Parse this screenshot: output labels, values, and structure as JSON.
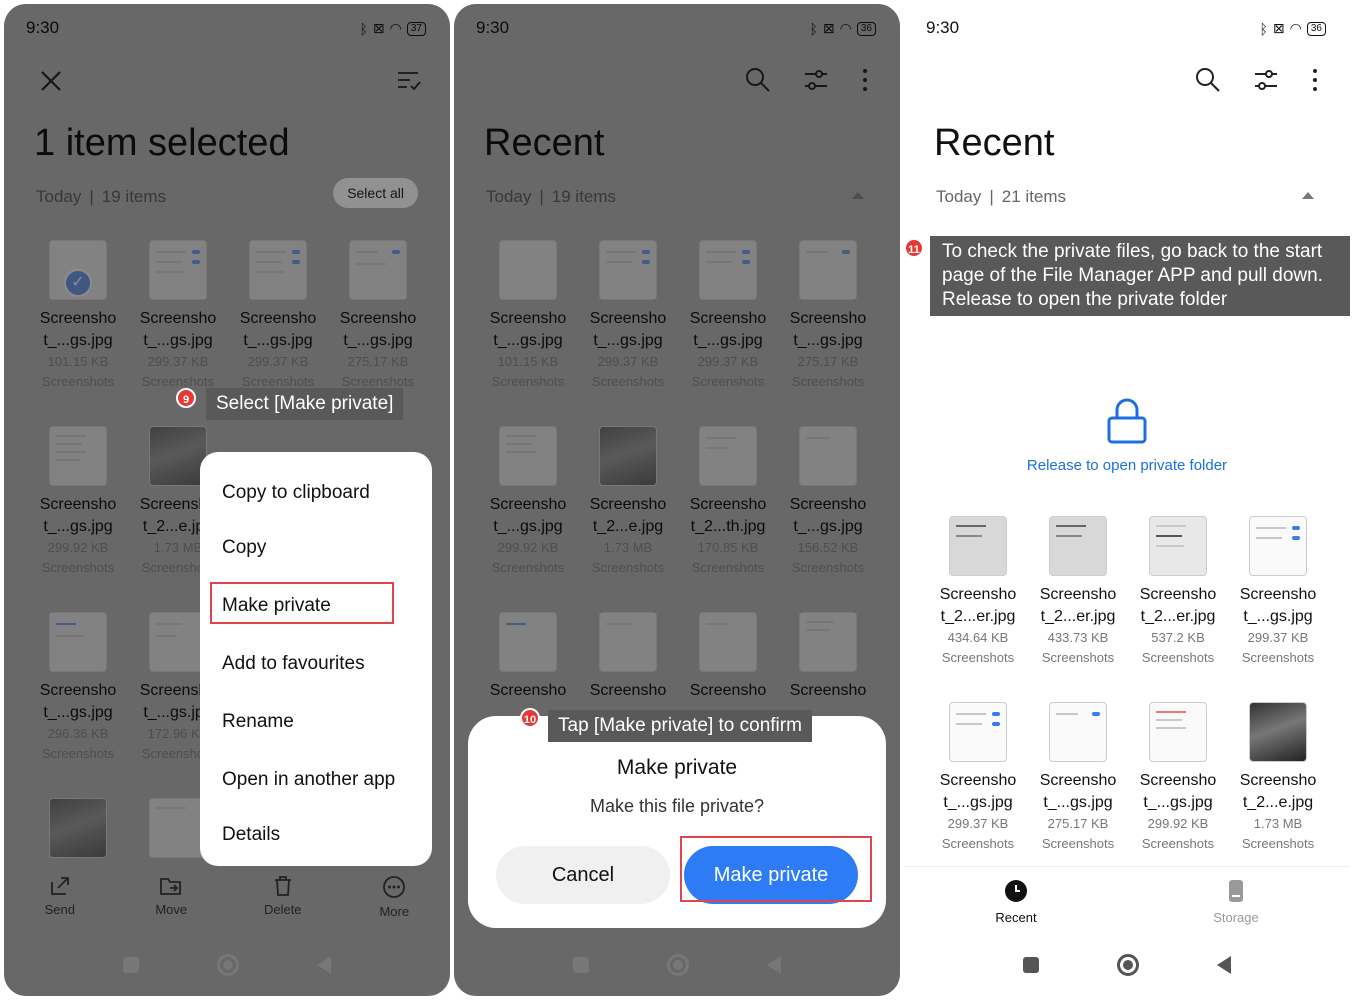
{
  "status": {
    "p1": {
      "time": "9:30",
      "battery": "37"
    },
    "p2": {
      "time": "9:30",
      "battery": "36"
    },
    "p3": {
      "time": "9:30",
      "battery": "36"
    }
  },
  "panel1": {
    "title": "1 item selected",
    "subhead": {
      "day": "Today",
      "sep": "|",
      "count": "19 items"
    },
    "select_all": "Select all",
    "files": [
      {
        "name1": "Screensho",
        "name2": "t_...gs.jpg",
        "size": "101.15 KB",
        "folder": "Screenshots"
      },
      {
        "name1": "Screensho",
        "name2": "t_...gs.jpg",
        "size": "299.37 KB",
        "folder": "Screenshots"
      },
      {
        "name1": "Screensho",
        "name2": "t_...gs.jpg",
        "size": "299.37 KB",
        "folder": "Screenshots"
      },
      {
        "name1": "Screensho",
        "name2": "t_...gs.jpg",
        "size": "275.17 KB",
        "folder": "Screenshots"
      },
      {
        "name1": "Screensho",
        "name2": "t_...gs.jpg",
        "size": "299.92 KB",
        "folder": "Screenshots"
      },
      {
        "name1": "Screensho",
        "name2": "t_2...e.jpg",
        "size": "1.73 MB",
        "folder": "Screenshots"
      },
      {
        "name1": "Screensho",
        "name2": "t_...gs.jpg",
        "size": "296.36 KB",
        "folder": "Screenshots"
      },
      {
        "name1": "Screensho",
        "name2": "t_...gs.jpg",
        "size": "172.96 KB",
        "folder": "Screenshots"
      }
    ],
    "menu": [
      "Copy to clipboard",
      "Copy",
      "Make private",
      "Add to favourites",
      "Rename",
      "Open in another app",
      "Details"
    ],
    "callout": {
      "num": "9",
      "text": "Select [Make private]"
    },
    "actions": [
      "Send",
      "Move",
      "Delete",
      "More"
    ]
  },
  "panel2": {
    "title": "Recent",
    "subhead": {
      "day": "Today",
      "sep": "|",
      "count": "19 items"
    },
    "files": [
      {
        "name1": "Screensho",
        "name2": "t_...gs.jpg",
        "size": "101.15 KB",
        "folder": "Screenshots"
      },
      {
        "name1": "Screensho",
        "name2": "t_...gs.jpg",
        "size": "299.37 KB",
        "folder": "Screenshots"
      },
      {
        "name1": "Screensho",
        "name2": "t_...gs.jpg",
        "size": "299.37 KB",
        "folder": "Screenshots"
      },
      {
        "name1": "Screensho",
        "name2": "t_...gs.jpg",
        "size": "275.17 KB",
        "folder": "Screenshots"
      },
      {
        "name1": "Screensho",
        "name2": "t_...gs.jpg",
        "size": "299.92 KB",
        "folder": "Screenshots"
      },
      {
        "name1": "Screensho",
        "name2": "t_2...e.jpg",
        "size": "1.73 MB",
        "folder": "Screenshots"
      },
      {
        "name1": "Screensho",
        "name2": "t_2...th.jpg",
        "size": "170.85 KB",
        "folder": "Screenshots"
      },
      {
        "name1": "Screensho",
        "name2": "t_...gs.jpg",
        "size": "156.52 KB",
        "folder": "Screenshots"
      },
      {
        "name1": "Screensho",
        "name2": "",
        "size": "",
        "folder": ""
      },
      {
        "name1": "Screensho",
        "name2": "",
        "size": "",
        "folder": ""
      },
      {
        "name1": "Screensho",
        "name2": "",
        "size": "",
        "folder": ""
      },
      {
        "name1": "Screensho",
        "name2": "",
        "size": "",
        "folder": ""
      }
    ],
    "dialog": {
      "title": "Make private",
      "message": "Make this file private?",
      "cancel": "Cancel",
      "confirm": "Make private"
    },
    "callout": {
      "num": "10",
      "text": "Tap [Make private] to confirm"
    }
  },
  "panel3": {
    "title": "Recent",
    "subhead": {
      "day": "Today",
      "sep": "|",
      "count": "21 items"
    },
    "callout": {
      "num": "11",
      "line1": "To check the private files, go back to the start",
      "line2": "page of the File Manager APP and pull down.",
      "line3": "Release to open the private folder"
    },
    "private_label": "Release to open private folder",
    "files": [
      {
        "name1": "Screensho",
        "name2": "t_2...er.jpg",
        "size": "434.64 KB",
        "folder": "Screenshots"
      },
      {
        "name1": "Screensho",
        "name2": "t_2...er.jpg",
        "size": "433.73 KB",
        "folder": "Screenshots"
      },
      {
        "name1": "Screensho",
        "name2": "t_2...er.jpg",
        "size": "537.2 KB",
        "folder": "Screenshots"
      },
      {
        "name1": "Screensho",
        "name2": "t_...gs.jpg",
        "size": "299.37 KB",
        "folder": "Screenshots"
      },
      {
        "name1": "Screensho",
        "name2": "t_...gs.jpg",
        "size": "299.37 KB",
        "folder": "Screenshots"
      },
      {
        "name1": "Screensho",
        "name2": "t_...gs.jpg",
        "size": "275.17 KB",
        "folder": "Screenshots"
      },
      {
        "name1": "Screensho",
        "name2": "t_...gs.jpg",
        "size": "299.92 KB",
        "folder": "Screenshots"
      },
      {
        "name1": "Screensho",
        "name2": "t_2...e.jpg",
        "size": "1.73 MB",
        "folder": "Screenshots"
      }
    ],
    "tabs": [
      "Recent",
      "Storage"
    ]
  }
}
